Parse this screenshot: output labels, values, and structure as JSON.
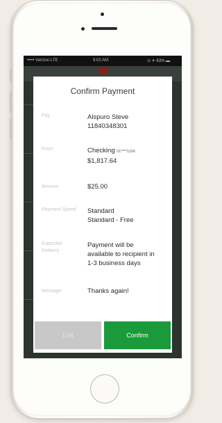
{
  "status_bar": {
    "carrier": "••••• Verizon LTE",
    "time": "9:02 AM",
    "battery": "⊙ ✈ 63% ▬"
  },
  "dialog": {
    "title": "Confirm Payment",
    "rows": [
      {
        "label": "Pay",
        "value_line1": "Alspuro Steve",
        "value_line2": "11840348301"
      },
      {
        "label": "From",
        "value_line1": "Checking",
        "value_line1_suffix": "01****1156",
        "value_line2": "$1,817.64"
      },
      {
        "label": "Amount",
        "value_line1": "$25.00"
      },
      {
        "label": "Payment Speed",
        "value_line1": "Standard",
        "value_line2": "Standard - Free"
      },
      {
        "label": "Expected Delivery",
        "value_line1": "Payment will be",
        "value_line2": "available to recipient in",
        "value_line3": "1-3 business days"
      },
      {
        "label": "Message",
        "value_line1": "Thanks again!"
      }
    ],
    "edit_label": "Edit",
    "confirm_label": "Confirm"
  },
  "colors": {
    "confirm_button": "#1a9a3a",
    "edit_button": "#c8c8c8",
    "overlay": "#2d332f"
  }
}
